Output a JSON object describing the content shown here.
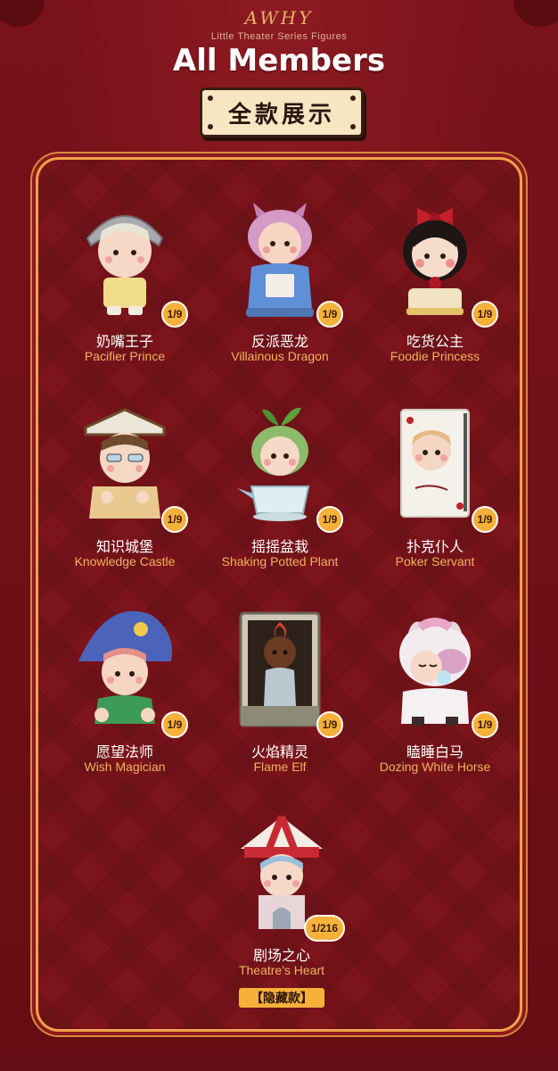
{
  "header": {
    "brand": "AWHY",
    "subtitle": "Little Theater Series Figures",
    "title": "All Members",
    "badge": "全款展示"
  },
  "members": [
    {
      "cn": "奶嘴王子",
      "en": "Pacifier Prince",
      "ratio": "1/9"
    },
    {
      "cn": "反派恶龙",
      "en": "Villainous Dragon",
      "ratio": "1/9"
    },
    {
      "cn": "吃货公主",
      "en": "Foodie Princess",
      "ratio": "1/9"
    },
    {
      "cn": "知识城堡",
      "en": "Knowledge Castle",
      "ratio": "1/9"
    },
    {
      "cn": "摇摇盆栽",
      "en": "Shaking Potted Plant",
      "ratio": "1/9"
    },
    {
      "cn": "扑克仆人",
      "en": "Poker Servant",
      "ratio": "1/9"
    },
    {
      "cn": "愿望法师",
      "en": "Wish Magician",
      "ratio": "1/9"
    },
    {
      "cn": "火焰精灵",
      "en": "Flame Elf",
      "ratio": "1/9"
    },
    {
      "cn": "瞌睡白马",
      "en": "Dozing White Horse",
      "ratio": "1/9"
    },
    {
      "cn": "剧场之心",
      "en": "Theatre's Heart",
      "ratio": "1/216",
      "tag": "【隐藏款】"
    }
  ],
  "colors": {
    "background": "#6e0f16",
    "panel_border": "#f0a24a",
    "accent": "#f6b13a",
    "english_label": "#f0b35e"
  }
}
